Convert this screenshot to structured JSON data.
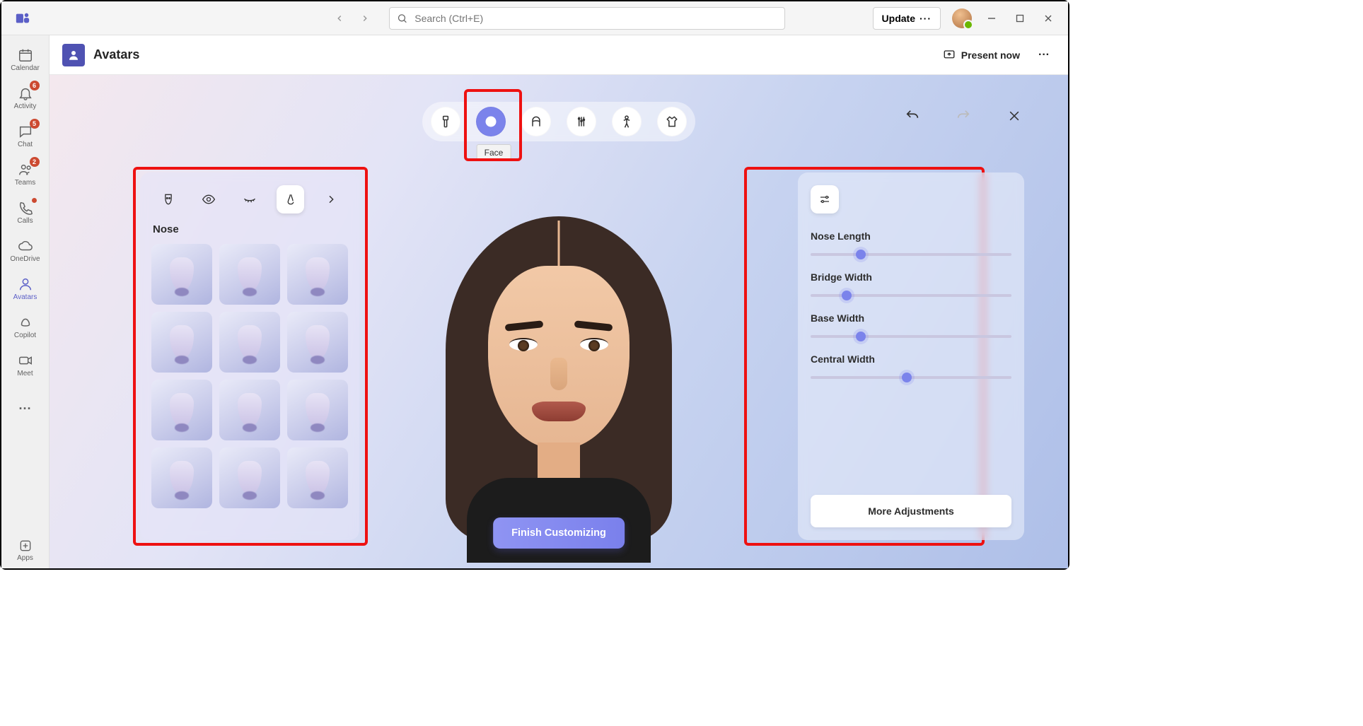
{
  "titlebar": {
    "search_placeholder": "Search (Ctrl+E)",
    "update_label": "Update"
  },
  "rail": {
    "items": [
      {
        "label": "Calendar",
        "icon": "calendar",
        "badge": null,
        "dot": false
      },
      {
        "label": "Activity",
        "icon": "bell",
        "badge": "6",
        "dot": false
      },
      {
        "label": "Chat",
        "icon": "chat",
        "badge": "5",
        "dot": false
      },
      {
        "label": "Teams",
        "icon": "people",
        "badge": "2",
        "dot": false
      },
      {
        "label": "Calls",
        "icon": "phone",
        "badge": null,
        "dot": true
      },
      {
        "label": "OneDrive",
        "icon": "cloud",
        "badge": null,
        "dot": false
      },
      {
        "label": "Avatars",
        "icon": "person",
        "badge": null,
        "dot": false,
        "selected": true
      },
      {
        "label": "Copilot",
        "icon": "copilot",
        "badge": null,
        "dot": false
      },
      {
        "label": "Meet",
        "icon": "video",
        "badge": null,
        "dot": false
      }
    ],
    "apps_label": "Apps"
  },
  "header": {
    "title": "Avatars",
    "present_label": "Present now"
  },
  "categories": {
    "items": [
      "body",
      "face",
      "hair",
      "makeup",
      "figure",
      "wardrobe"
    ],
    "active_index": 1,
    "tooltip": "Face"
  },
  "left_panel": {
    "tabs": [
      "face-shape",
      "eyes",
      "lashes",
      "nose",
      "more"
    ],
    "active_tab_index": 3,
    "title": "Nose",
    "thumb_count": 12
  },
  "right_panel": {
    "sliders": [
      {
        "label": "Nose Length",
        "value": 25
      },
      {
        "label": "Bridge Width",
        "value": 18
      },
      {
        "label": "Base Width",
        "value": 25
      },
      {
        "label": "Central Width",
        "value": 48
      }
    ],
    "more_label": "More Adjustments"
  },
  "finish_label": "Finish Customizing"
}
